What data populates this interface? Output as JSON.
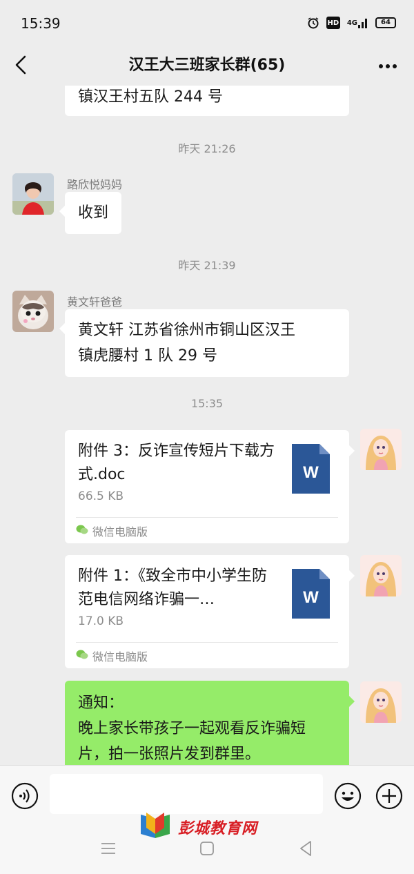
{
  "status_bar": {
    "time": "15:39",
    "hd": "HD",
    "network": "4G",
    "battery": "64"
  },
  "header": {
    "title": "汉王大三班家长群(65)"
  },
  "messages": {
    "m0_text": "镇汉王村五队 244 号",
    "ts1": "昨天 21:26",
    "m1_sender": "路欣悦妈妈",
    "m1_text": "收到",
    "ts2": "昨天 21:39",
    "m2_sender": "黄文轩爸爸",
    "m2_line1": "黄文轩  江苏省徐州市铜山区汉王",
    "m2_line2": "镇虎腰村 1 队 29 号",
    "ts3": "15:35",
    "f1_name": "附件 3：反诈宣传短片下载方式.doc",
    "f1_size": "66.5 KB",
    "f1_source": "微信电脑版",
    "f1_icon_letter": "W",
    "f2_name": "附件 1：《致全市中小学生防范电信网络诈骗一…",
    "f2_size": "17.0 KB",
    "f2_source": "微信电脑版",
    "f2_icon_letter": "W",
    "m5_line1": "通知：",
    "m5_line2": "晚上家长带孩子一起观看反诈骗短",
    "m5_line3": "片，拍一张照片发到群里。"
  },
  "watermark": {
    "text": "彭城教育网"
  },
  "colors": {
    "background": "#ededed",
    "sent_bubble": "#95ec69",
    "word_icon": "#2b5797"
  }
}
